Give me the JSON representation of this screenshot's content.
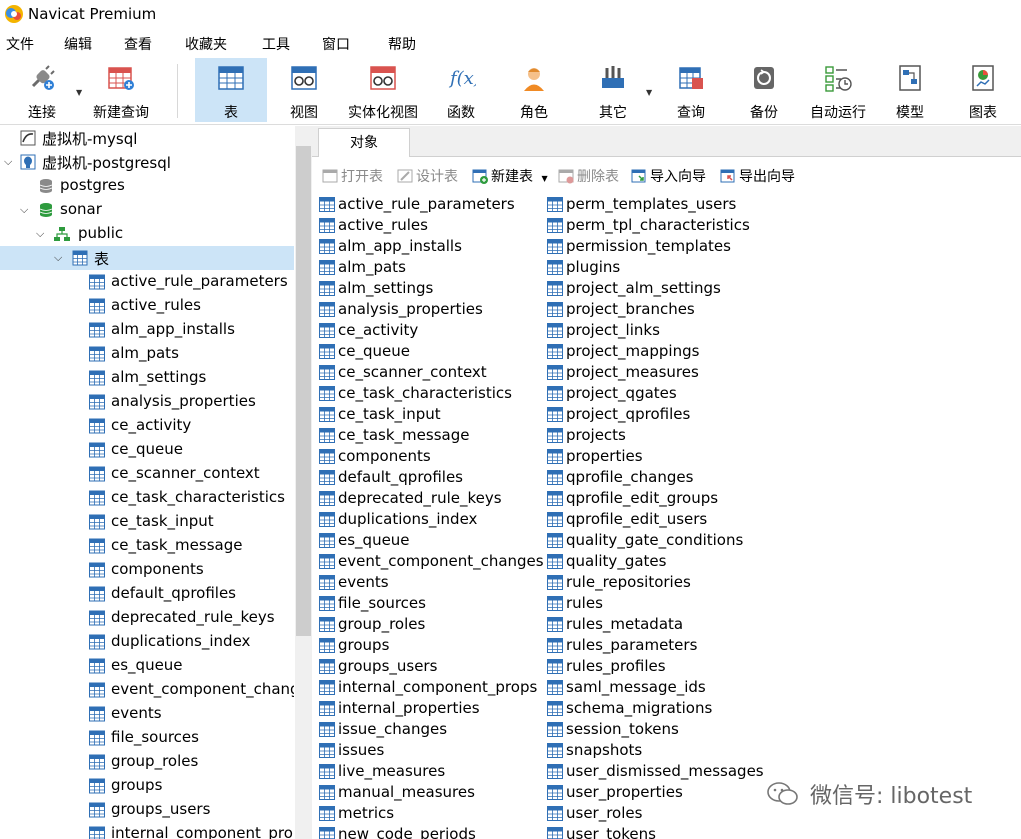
{
  "app": {
    "title": "Navicat Premium"
  },
  "menu": [
    "文件",
    "编辑",
    "查看",
    "收藏夹",
    "工具",
    "窗口",
    "帮助"
  ],
  "toolbar": [
    {
      "label": "连接",
      "icon": "plug-icon"
    },
    {
      "label": "新建查询",
      "icon": "new-query-icon"
    },
    {
      "label": "表",
      "icon": "table-icon"
    },
    {
      "label": "视图",
      "icon": "view-icon"
    },
    {
      "label": "实体化视图",
      "icon": "materialized-view-icon"
    },
    {
      "label": "函数",
      "icon": "function-icon"
    },
    {
      "label": "角色",
      "icon": "role-icon"
    },
    {
      "label": "其它",
      "icon": "tools-icon"
    },
    {
      "label": "查询",
      "icon": "query-icon"
    },
    {
      "label": "备份",
      "icon": "backup-icon"
    },
    {
      "label": "自动运行",
      "icon": "automation-icon"
    },
    {
      "label": "模型",
      "icon": "model-icon"
    },
    {
      "label": "图表",
      "icon": "chart-icon"
    }
  ],
  "tree": {
    "connections": [
      {
        "label": "虚拟机-mysql"
      },
      {
        "label": "虚拟机-postgresql"
      }
    ],
    "db_postgres": "postgres",
    "db_sonar": "sonar",
    "schema": "public",
    "tables_node": "表",
    "tables": [
      "active_rule_parameters",
      "active_rules",
      "alm_app_installs",
      "alm_pats",
      "alm_settings",
      "analysis_properties",
      "ce_activity",
      "ce_queue",
      "ce_scanner_context",
      "ce_task_characteristics",
      "ce_task_input",
      "ce_task_message",
      "components",
      "default_qprofiles",
      "deprecated_rule_keys",
      "duplications_index",
      "es_queue",
      "event_component_chang",
      "events",
      "file_sources",
      "group_roles",
      "groups",
      "groups_users",
      "internal_component_prop"
    ]
  },
  "tabs": {
    "objects": "对象"
  },
  "object_toolbar": {
    "open": "打开表",
    "design": "设计表",
    "new": "新建表",
    "delete": "删除表",
    "import": "导入向导",
    "export": "导出向导"
  },
  "objects": {
    "col1": [
      "active_rule_parameters",
      "active_rules",
      "alm_app_installs",
      "alm_pats",
      "alm_settings",
      "analysis_properties",
      "ce_activity",
      "ce_queue",
      "ce_scanner_context",
      "ce_task_characteristics",
      "ce_task_input",
      "ce_task_message",
      "components",
      "default_qprofiles",
      "deprecated_rule_keys",
      "duplications_index",
      "es_queue",
      "event_component_changes",
      "events",
      "file_sources",
      "group_roles",
      "groups",
      "groups_users",
      "internal_component_props",
      "internal_properties",
      "issue_changes",
      "issues",
      "live_measures",
      "manual_measures",
      "metrics",
      "new_code_periods"
    ],
    "col2": [
      "perm_templates_users",
      "perm_tpl_characteristics",
      "permission_templates",
      "plugins",
      "project_alm_settings",
      "project_branches",
      "project_links",
      "project_mappings",
      "project_measures",
      "project_qgates",
      "project_qprofiles",
      "projects",
      "properties",
      "qprofile_changes",
      "qprofile_edit_groups",
      "qprofile_edit_users",
      "quality_gate_conditions",
      "quality_gates",
      "rule_repositories",
      "rules",
      "rules_metadata",
      "rules_parameters",
      "rules_profiles",
      "saml_message_ids",
      "schema_migrations",
      "session_tokens",
      "snapshots",
      "user_dismissed_messages",
      "user_properties",
      "user_roles",
      "user_tokens"
    ]
  },
  "watermark": "微信号: libotest",
  "colors": {
    "selection": "#cce4f7",
    "table_icon": "#2f6fb5"
  }
}
